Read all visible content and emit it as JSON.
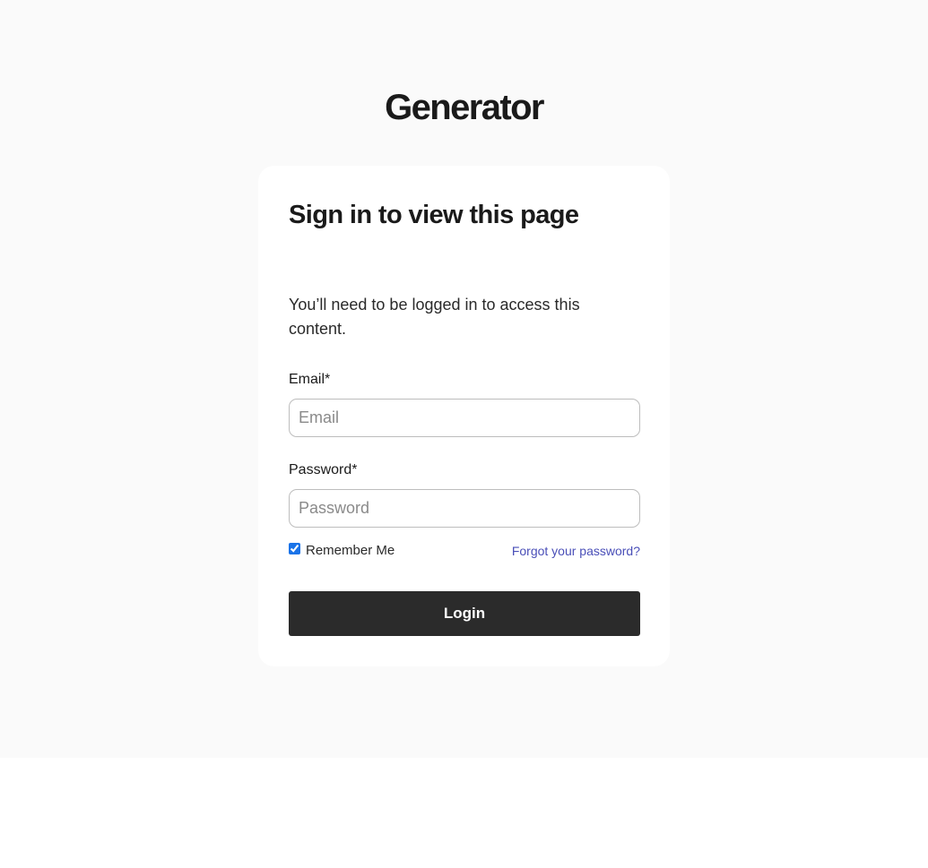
{
  "brand": {
    "logo_text": "Generator"
  },
  "login_card": {
    "title": "Sign in to view this page",
    "description": "You’ll need to be logged in to access this content.",
    "email": {
      "label": "Email*",
      "placeholder": "Email",
      "value": ""
    },
    "password": {
      "label": "Password*",
      "placeholder": "Password",
      "value": ""
    },
    "remember_me": {
      "label": "Remember Me",
      "checked": true
    },
    "forgot_password_label": "Forgot your password?",
    "login_button_label": "Login"
  },
  "colors": {
    "page_background": "#fafafa",
    "card_background": "#ffffff",
    "button_background": "#2b2b2b",
    "link": "#4a4fb8",
    "checkbox_accent": "#1a73e8"
  }
}
